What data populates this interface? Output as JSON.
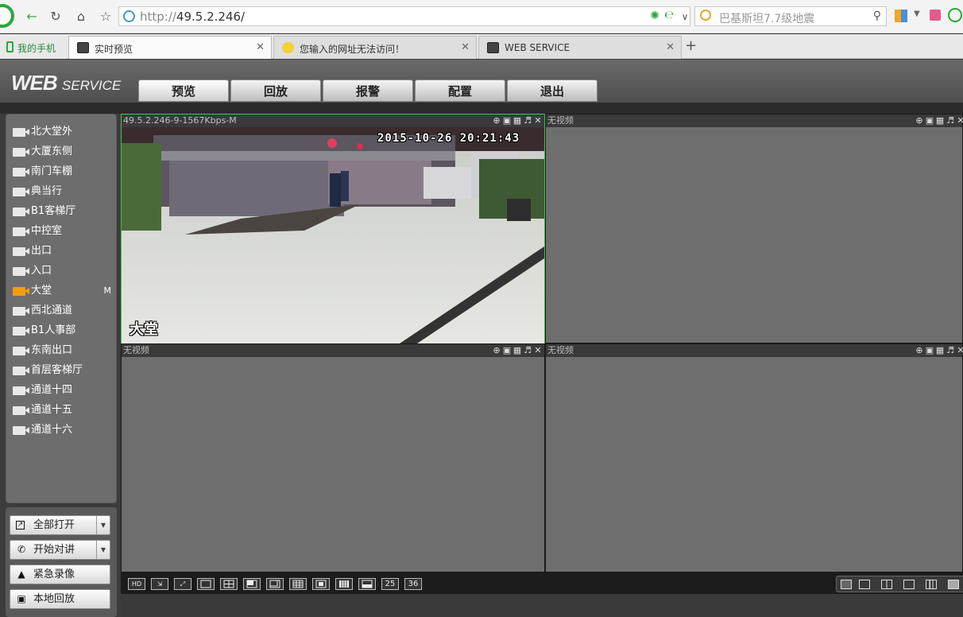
{
  "browser": {
    "url_prefix": "http://",
    "url_host": "49.5.2.246/",
    "search_placeholder": "巴基斯坦7.7级地震",
    "tabs": [
      {
        "label": "我的手机"
      },
      {
        "label": "实时预览"
      },
      {
        "label": "您输入的网址无法访问！"
      },
      {
        "label": "WEB SERVICE"
      }
    ],
    "new_tab_label": "+"
  },
  "header": {
    "brand_main": "WEB",
    "brand_sub": "SERVICE",
    "nav": [
      {
        "label": "预览"
      },
      {
        "label": "回放"
      },
      {
        "label": "报警"
      },
      {
        "label": "配置"
      },
      {
        "label": "退出"
      }
    ]
  },
  "channels": [
    {
      "label": "北大堂外"
    },
    {
      "label": "大厦东侧"
    },
    {
      "label": "南门车棚"
    },
    {
      "label": "典当行"
    },
    {
      "label": "B1客梯厅"
    },
    {
      "label": "中控室"
    },
    {
      "label": "出口"
    },
    {
      "label": "入口"
    },
    {
      "label": "大堂",
      "mark": "M"
    },
    {
      "label": "西北通道"
    },
    {
      "label": "B1人事部"
    },
    {
      "label": "东南出口"
    },
    {
      "label": "首层客梯厅"
    },
    {
      "label": "通道十四"
    },
    {
      "label": "通道十五"
    },
    {
      "label": "通道十六"
    }
  ],
  "controls": {
    "open_all": "全部打开",
    "start_talk": "开始对讲",
    "emergency_record": "紧急录像",
    "local_playback": "本地回放"
  },
  "panes": {
    "p1_title": "49.5.2.246-9-1567Kbps-M",
    "p1_timestamp": "2015-10-26 20:21:43",
    "p1_channel_overlay": "大堂",
    "empty_title": "无视频"
  },
  "layouts": {
    "n25": "25",
    "n36": "36"
  }
}
